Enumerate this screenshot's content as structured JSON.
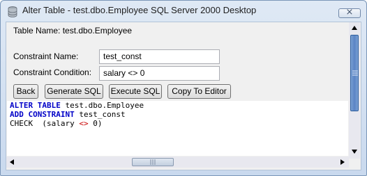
{
  "window": {
    "title": "Alter Table - test.dbo.Employee SQL Server 2000 Desktop",
    "close_glyph": "⨯"
  },
  "form": {
    "table_name_label": "Table Name: test.dbo.Employee",
    "constraint_name_label": "Constraint Name:",
    "constraint_name_value": "test_const",
    "constraint_condition_label": "Constraint Condition:",
    "constraint_condition_value": "salary <> 0"
  },
  "buttons": {
    "back": "Back",
    "generate_sql": "Generate SQL",
    "execute_sql": "Execute SQL",
    "copy_to_editor": "Copy To Editor"
  },
  "sql": {
    "line1_kw": "ALTER TABLE",
    "line1_rest": " test.dbo.Employee",
    "line2_kw": "ADD CONSTRAINT",
    "line2_rest": " test_const",
    "line3_start": "CHECK  (salary ",
    "line3_op": "<>",
    "line3_end": " 0)"
  },
  "colors": {
    "keyword": "#0000c8",
    "operator": "#c80000",
    "scroll_thumb": "#5b84c4"
  }
}
